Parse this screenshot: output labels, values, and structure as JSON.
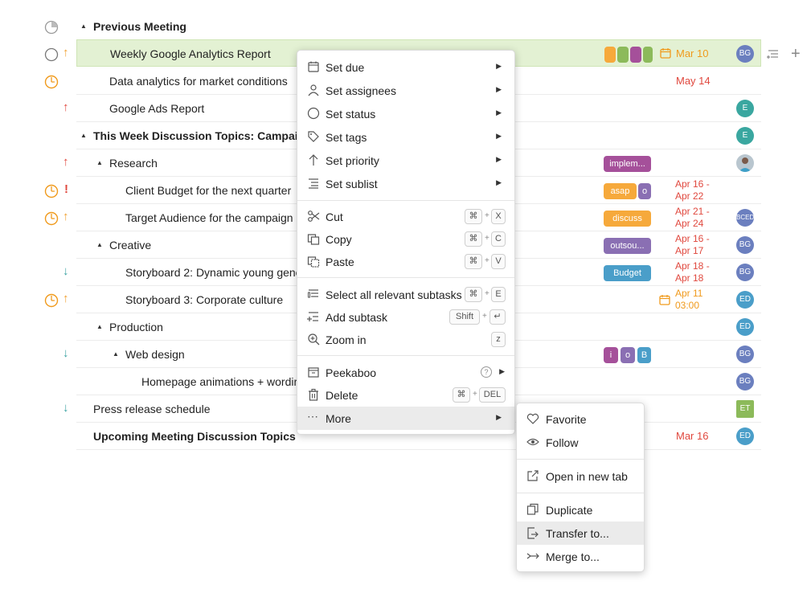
{
  "rows": {
    "previous_meeting": "Previous Meeting",
    "weekly_report": "Weekly Google Analytics Report",
    "data_analytics": "Data analytics for market conditions",
    "google_ads": "Google Ads Report",
    "this_week": "This Week Discussion Topics: Campaign",
    "research": "Research",
    "client_budget": "Client Budget for the next quarter",
    "target_audience": "Target Audience for the campaign",
    "creative": "Creative",
    "storyboard2": "Storyboard 2: Dynamic young gene",
    "storyboard3": "Storyboard 3: Corporate culture",
    "production": "Production",
    "web_design": "Web design",
    "homepage": "Homepage animations + wordir",
    "press_release": "Press release schedule",
    "upcoming": "Upcoming Meeting Discussion Topics"
  },
  "tags": {
    "implem": "implem...",
    "asap": "asap",
    "o": "o",
    "discuss": "discuss",
    "outsou": "outsou...",
    "budget": "Budget",
    "i": "i",
    "b": "B"
  },
  "dates": {
    "weekly": "Mar 10",
    "data_analytics": "May 14",
    "client_budget_1": "Apr 16 -",
    "client_budget_2": "Apr 22",
    "target_1": "Apr 21 -",
    "target_2": "Apr 24",
    "creative_1": "Apr 16 -",
    "creative_2": "Apr 17",
    "storyboard2_1": "Apr 18 -",
    "storyboard2_2": "Apr 18",
    "storyboard3_1": "Apr 11",
    "storyboard3_2": "03:00",
    "upcoming": "Mar 16"
  },
  "avatars": {
    "bg": "BG",
    "e": "E",
    "ed": "ED",
    "et": "ET",
    "bced": "BCED"
  },
  "context_menu": {
    "set_due": "Set due",
    "set_assignees": "Set assignees",
    "set_status": "Set status",
    "set_tags": "Set tags",
    "set_priority": "Set priority",
    "set_sublist": "Set sublist",
    "cut": "Cut",
    "copy": "Copy",
    "paste": "Paste",
    "select_all": "Select all relevant subtasks",
    "add_subtask": "Add subtask",
    "zoom_in": "Zoom in",
    "peekaboo": "Peekaboo",
    "delete": "Delete",
    "more": "More",
    "keys": {
      "cmd": "⌘",
      "x": "X",
      "c": "C",
      "v": "V",
      "e": "E",
      "shift": "Shift",
      "enter": "↵",
      "z": "z",
      "del": "DEL",
      "plus": "+",
      "help": "?"
    }
  },
  "more_menu": {
    "favorite": "Favorite",
    "follow": "Follow",
    "open_new_tab": "Open in new tab",
    "duplicate": "Duplicate",
    "transfer": "Transfer to...",
    "merge": "Merge to..."
  },
  "colors": {
    "highlight_row": "#e3f1d3",
    "priority_high": "#e0483e",
    "priority_medium": "#f0a030",
    "priority_low": "#3aa3a3",
    "tag_purple": "#a5509a",
    "tag_orange": "#f6a93b",
    "tag_violet": "#8a6fb3",
    "tag_blue": "#4a9ec9",
    "tag_green": "#8cba5a",
    "avatar_blue": "#6b7fbf",
    "avatar_teal": "#3aa7a0"
  }
}
